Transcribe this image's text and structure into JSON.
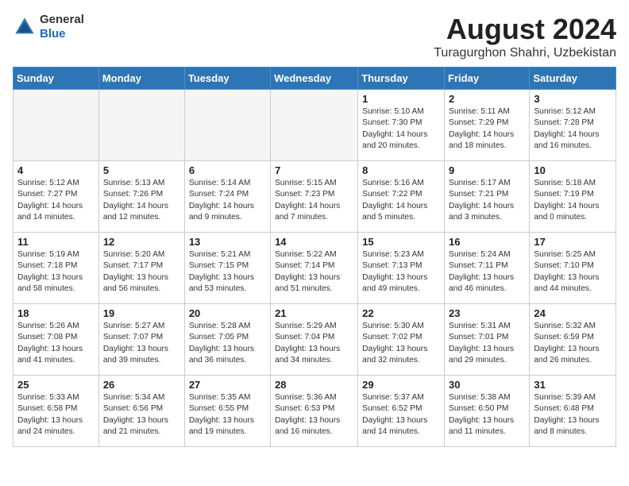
{
  "header": {
    "logo_line1": "General",
    "logo_line2": "Blue",
    "month_title": "August 2024",
    "subtitle": "Turagurghon Shahri, Uzbekistan"
  },
  "days_of_week": [
    "Sunday",
    "Monday",
    "Tuesday",
    "Wednesday",
    "Thursday",
    "Friday",
    "Saturday"
  ],
  "weeks": [
    [
      {
        "day": "",
        "info": ""
      },
      {
        "day": "",
        "info": ""
      },
      {
        "day": "",
        "info": ""
      },
      {
        "day": "",
        "info": ""
      },
      {
        "day": "1",
        "info": "Sunrise: 5:10 AM\nSunset: 7:30 PM\nDaylight: 14 hours\nand 20 minutes."
      },
      {
        "day": "2",
        "info": "Sunrise: 5:11 AM\nSunset: 7:29 PM\nDaylight: 14 hours\nand 18 minutes."
      },
      {
        "day": "3",
        "info": "Sunrise: 5:12 AM\nSunset: 7:28 PM\nDaylight: 14 hours\nand 16 minutes."
      }
    ],
    [
      {
        "day": "4",
        "info": "Sunrise: 5:12 AM\nSunset: 7:27 PM\nDaylight: 14 hours\nand 14 minutes."
      },
      {
        "day": "5",
        "info": "Sunrise: 5:13 AM\nSunset: 7:26 PM\nDaylight: 14 hours\nand 12 minutes."
      },
      {
        "day": "6",
        "info": "Sunrise: 5:14 AM\nSunset: 7:24 PM\nDaylight: 14 hours\nand 9 minutes."
      },
      {
        "day": "7",
        "info": "Sunrise: 5:15 AM\nSunset: 7:23 PM\nDaylight: 14 hours\nand 7 minutes."
      },
      {
        "day": "8",
        "info": "Sunrise: 5:16 AM\nSunset: 7:22 PM\nDaylight: 14 hours\nand 5 minutes."
      },
      {
        "day": "9",
        "info": "Sunrise: 5:17 AM\nSunset: 7:21 PM\nDaylight: 14 hours\nand 3 minutes."
      },
      {
        "day": "10",
        "info": "Sunrise: 5:18 AM\nSunset: 7:19 PM\nDaylight: 14 hours\nand 0 minutes."
      }
    ],
    [
      {
        "day": "11",
        "info": "Sunrise: 5:19 AM\nSunset: 7:18 PM\nDaylight: 13 hours\nand 58 minutes."
      },
      {
        "day": "12",
        "info": "Sunrise: 5:20 AM\nSunset: 7:17 PM\nDaylight: 13 hours\nand 56 minutes."
      },
      {
        "day": "13",
        "info": "Sunrise: 5:21 AM\nSunset: 7:15 PM\nDaylight: 13 hours\nand 53 minutes."
      },
      {
        "day": "14",
        "info": "Sunrise: 5:22 AM\nSunset: 7:14 PM\nDaylight: 13 hours\nand 51 minutes."
      },
      {
        "day": "15",
        "info": "Sunrise: 5:23 AM\nSunset: 7:13 PM\nDaylight: 13 hours\nand 49 minutes."
      },
      {
        "day": "16",
        "info": "Sunrise: 5:24 AM\nSunset: 7:11 PM\nDaylight: 13 hours\nand 46 minutes."
      },
      {
        "day": "17",
        "info": "Sunrise: 5:25 AM\nSunset: 7:10 PM\nDaylight: 13 hours\nand 44 minutes."
      }
    ],
    [
      {
        "day": "18",
        "info": "Sunrise: 5:26 AM\nSunset: 7:08 PM\nDaylight: 13 hours\nand 41 minutes."
      },
      {
        "day": "19",
        "info": "Sunrise: 5:27 AM\nSunset: 7:07 PM\nDaylight: 13 hours\nand 39 minutes."
      },
      {
        "day": "20",
        "info": "Sunrise: 5:28 AM\nSunset: 7:05 PM\nDaylight: 13 hours\nand 36 minutes."
      },
      {
        "day": "21",
        "info": "Sunrise: 5:29 AM\nSunset: 7:04 PM\nDaylight: 13 hours\nand 34 minutes."
      },
      {
        "day": "22",
        "info": "Sunrise: 5:30 AM\nSunset: 7:02 PM\nDaylight: 13 hours\nand 32 minutes."
      },
      {
        "day": "23",
        "info": "Sunrise: 5:31 AM\nSunset: 7:01 PM\nDaylight: 13 hours\nand 29 minutes."
      },
      {
        "day": "24",
        "info": "Sunrise: 5:32 AM\nSunset: 6:59 PM\nDaylight: 13 hours\nand 26 minutes."
      }
    ],
    [
      {
        "day": "25",
        "info": "Sunrise: 5:33 AM\nSunset: 6:58 PM\nDaylight: 13 hours\nand 24 minutes."
      },
      {
        "day": "26",
        "info": "Sunrise: 5:34 AM\nSunset: 6:56 PM\nDaylight: 13 hours\nand 21 minutes."
      },
      {
        "day": "27",
        "info": "Sunrise: 5:35 AM\nSunset: 6:55 PM\nDaylight: 13 hours\nand 19 minutes."
      },
      {
        "day": "28",
        "info": "Sunrise: 5:36 AM\nSunset: 6:53 PM\nDaylight: 13 hours\nand 16 minutes."
      },
      {
        "day": "29",
        "info": "Sunrise: 5:37 AM\nSunset: 6:52 PM\nDaylight: 13 hours\nand 14 minutes."
      },
      {
        "day": "30",
        "info": "Sunrise: 5:38 AM\nSunset: 6:50 PM\nDaylight: 13 hours\nand 11 minutes."
      },
      {
        "day": "31",
        "info": "Sunrise: 5:39 AM\nSunset: 6:48 PM\nDaylight: 13 hours\nand 8 minutes."
      }
    ]
  ]
}
